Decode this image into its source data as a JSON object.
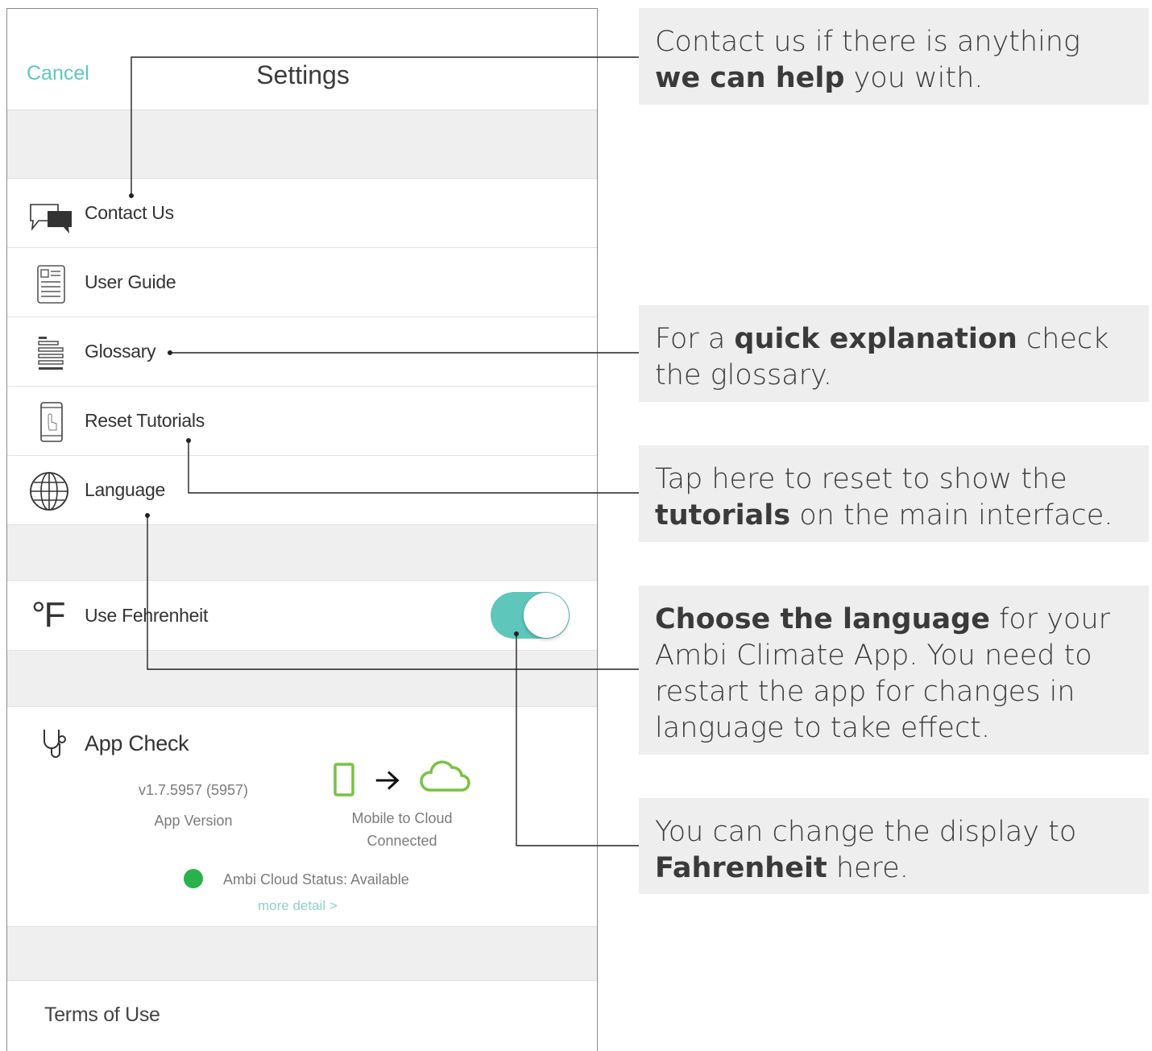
{
  "nav": {
    "cancel": "Cancel",
    "title": "Settings"
  },
  "menu": [
    {
      "label": "Contact Us",
      "icon": "chat-bubbles-icon"
    },
    {
      "label": "User Guide",
      "icon": "document-icon"
    },
    {
      "label": "Glossary",
      "icon": "list-icon"
    },
    {
      "label": "Reset Tutorials",
      "icon": "phone-tap-icon"
    },
    {
      "label": "Language",
      "icon": "globe-icon"
    }
  ],
  "fahrenheit": {
    "symbol": "°F",
    "label": "Use Fehrenheit",
    "toggle_on": true
  },
  "app_check": {
    "title": "App Check",
    "version": "v1.7.5957 (5957)",
    "version_label": "App Version",
    "connection_line1": "Mobile to Cloud",
    "connection_line2": "Connected",
    "cloud_status": "Ambi Cloud Status: Available",
    "more_detail": "more detail >"
  },
  "terms": "Terms of Use",
  "callouts": {
    "contact": {
      "pre": "Contact us if there is anything ",
      "bold": "we can help",
      "post": " you with."
    },
    "glossary": {
      "pre": "For a ",
      "bold": "quick explanation",
      "post": " check the glossary."
    },
    "tutorials": {
      "pre": "Tap here to reset to show the ",
      "bold": "tutorials",
      "post": " on the main interface."
    },
    "language": {
      "bold": "Choose the language",
      "post": " for your Ambi Climate App. You need to restart the app for changes in language to take effect."
    },
    "fahrenheit": {
      "pre": "You can change the display to ",
      "bold": "Fahrenheit",
      "post": " here."
    }
  },
  "colors": {
    "accent": "#5cc8bd",
    "green": "#27b24a",
    "icon_green": "#7ac143"
  }
}
